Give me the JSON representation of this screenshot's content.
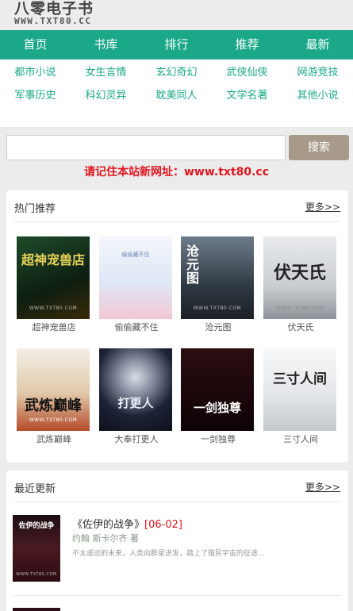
{
  "logo": {
    "cn": "八零电子书",
    "en": "WWW.TXT80.CC"
  },
  "nav": [
    "首页",
    "书库",
    "排行",
    "推荐",
    "最新"
  ],
  "categories": [
    [
      "都市小说",
      "女生言情",
      "玄幻奇幻",
      "武侠仙侠",
      "网游竞技"
    ],
    [
      "军事历史",
      "科幻灵异",
      "耽美同人",
      "文学名著",
      "其他小说"
    ]
  ],
  "search": {
    "placeholder": "",
    "button": "搜索"
  },
  "notice": "请记住本站新网址：www.txt80.cc",
  "hot": {
    "title": "热门推荐",
    "more": "更多>>",
    "books": [
      {
        "title": "超神宠兽店",
        "cover_text": "超神宠兽店"
      },
      {
        "title": "偷偷藏不住",
        "cover_text": "偷偷藏不住"
      },
      {
        "title": "沧元图",
        "cover_text": "沧元图"
      },
      {
        "title": "伏天氏",
        "cover_text": "伏天氏"
      },
      {
        "title": "武炼巅峰",
        "cover_text": "武炼巅峰"
      },
      {
        "title": "大奉打更人",
        "cover_text": "打更人"
      },
      {
        "title": "一剑独尊",
        "cover_text": "一剑独尊"
      },
      {
        "title": "三寸人间",
        "cover_text": "三寸人间"
      }
    ],
    "cover_url": "WWW.TXT80.COM"
  },
  "recent": {
    "title": "最近更新",
    "more": "更多>>",
    "items": [
      {
        "title": "《佐伊的战争》",
        "date": "[06-02]",
        "author": "约翰 斯卡尔齐 著",
        "desc": "不太遥远的未来，人类向群星进发，踏上了殖民宇宙的征途...",
        "cover_text": "佐伊的战争"
      }
    ]
  }
}
